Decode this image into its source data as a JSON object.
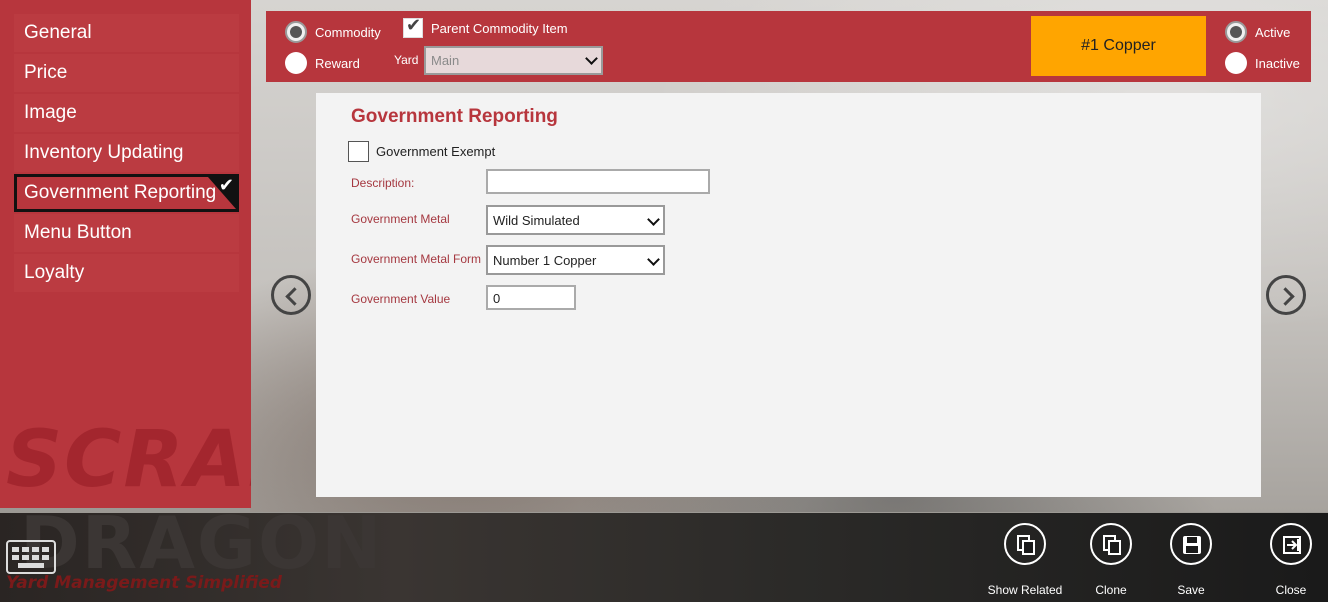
{
  "sidebar": {
    "items": [
      {
        "label": "General"
      },
      {
        "label": "Price"
      },
      {
        "label": "Image"
      },
      {
        "label": "Inventory Updating"
      },
      {
        "label": "Government Reporting",
        "selected": true
      },
      {
        "label": "Menu Button"
      },
      {
        "label": "Loyalty"
      }
    ],
    "watermark": "SCRAP"
  },
  "topbar": {
    "commodity_label": "Commodity",
    "reward_label": "Reward",
    "parent_commodity_label": "Parent Commodity Item",
    "yard_label": "Yard",
    "yard_value": "Main",
    "badge": "#1 Copper",
    "active_label": "Active",
    "inactive_label": "Inactive"
  },
  "form": {
    "title": "Government Reporting",
    "exempt_label": "Government Exempt",
    "description_label": "Description:",
    "description_value": "",
    "metal_label": "Government Metal",
    "metal_value": "Wild Simulated",
    "metal_form_label": "Government Metal Form",
    "metal_form_value": "Number 1 Copper",
    "value_label": "Government Value",
    "value_value": "0"
  },
  "bottom": {
    "logo": "DRAGON",
    "tagline": "Yard Management Simplified",
    "show_related": "Show Related",
    "clone": "Clone",
    "save": "Save",
    "close": "Close"
  },
  "colors": {
    "accent": "#b7363d",
    "badge": "#ffa500",
    "label": "#a53840"
  }
}
